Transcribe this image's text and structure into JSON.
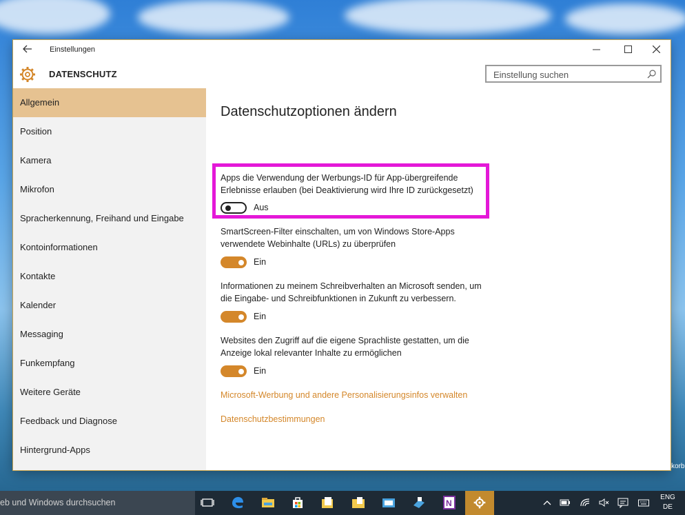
{
  "window": {
    "title": "Einstellungen"
  },
  "header": {
    "section": "DATENSCHUTZ",
    "search_placeholder": "Einstellung suchen"
  },
  "sidebar": {
    "items": [
      {
        "label": "Allgemein",
        "active": true
      },
      {
        "label": "Position"
      },
      {
        "label": "Kamera"
      },
      {
        "label": "Mikrofon"
      },
      {
        "label": "Spracherkennung, Freihand und Eingabe"
      },
      {
        "label": "Kontoinformationen"
      },
      {
        "label": "Kontakte"
      },
      {
        "label": "Kalender"
      },
      {
        "label": "Messaging"
      },
      {
        "label": "Funkempfang"
      },
      {
        "label": "Weitere Geräte"
      },
      {
        "label": "Feedback und Diagnose"
      },
      {
        "label": "Hintergrund-Apps"
      }
    ]
  },
  "content": {
    "heading": "Datenschutzoptionen ändern",
    "options": [
      {
        "text": "Apps die Verwendung der Werbungs-ID für App-übergreifende Erlebnisse erlauben (bei Deaktivierung wird Ihre ID zurückgesetzt)",
        "state_label": "Aus",
        "on": false
      },
      {
        "text": "SmartScreen-Filter einschalten, um von Windows Store-Apps verwendete Webinhalte (URLs) zu überprüfen",
        "state_label": "Ein",
        "on": true
      },
      {
        "text": "Informationen zu meinem Schreibverhalten an Microsoft senden, um die Eingabe- und Schreibfunktionen in Zukunft zu verbessern.",
        "state_label": "Ein",
        "on": true
      },
      {
        "text": "Websites den Zugriff auf die eigene Sprachliste gestatten, um die Anzeige lokal relevanter Inhalte zu ermöglichen",
        "state_label": "Ein",
        "on": true
      }
    ],
    "links": [
      "Microsoft-Werbung und andere Personalisierungsinfos verwalten",
      "Datenschutzbestimmungen"
    ]
  },
  "taskbar": {
    "search_text": "eb und Windows durchsuchen",
    "lang_top": "ENG",
    "lang_bottom": "DE"
  },
  "desktop": {
    "recycle_label": "korb"
  },
  "colors": {
    "accent": "#d4872a",
    "highlight_border": "#e418d8",
    "active_nav": "#e6c291"
  },
  "icons": [
    "back-arrow-icon",
    "gear-icon",
    "search-icon",
    "task-view-icon",
    "edge-icon",
    "explorer-icon",
    "store-icon",
    "onenote-icon",
    "settings-icon"
  ]
}
